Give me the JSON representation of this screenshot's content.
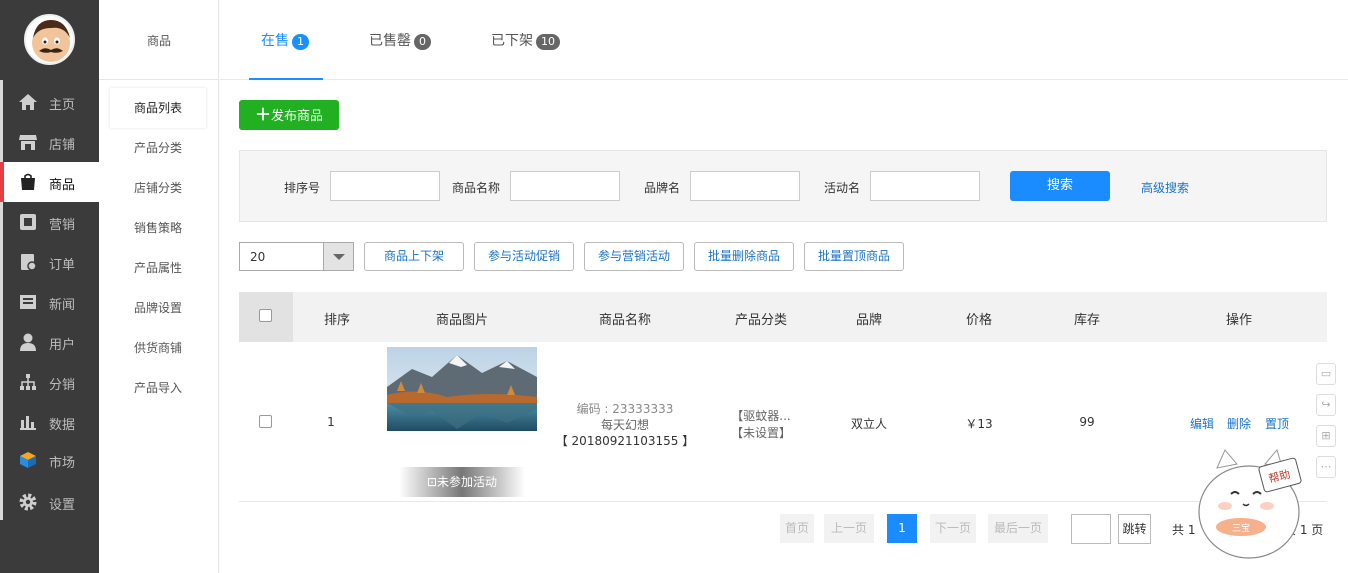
{
  "nav": {
    "items": [
      {
        "label": "主页",
        "icon": "home-icon"
      },
      {
        "label": "店铺",
        "icon": "shop-icon"
      },
      {
        "label": "商品",
        "icon": "bag-icon"
      },
      {
        "label": "营销",
        "icon": "marketing-icon"
      },
      {
        "label": "订单",
        "icon": "order-icon"
      },
      {
        "label": "新闻",
        "icon": "news-icon"
      },
      {
        "label": "用户",
        "icon": "user-icon"
      },
      {
        "label": "分销",
        "icon": "distribution-icon"
      },
      {
        "label": "数据",
        "icon": "chart-icon"
      },
      {
        "label": "市场",
        "icon": "market-icon"
      },
      {
        "label": "设置",
        "icon": "gear-icon"
      }
    ],
    "active_index": 2
  },
  "subnav": {
    "title": "商品",
    "items": [
      "商品列表",
      "产品分类",
      "店铺分类",
      "销售策略",
      "产品属性",
      "品牌设置",
      "供货商铺",
      "产品导入"
    ]
  },
  "tabs": [
    {
      "label": "在售",
      "count": "1"
    },
    {
      "label": "已售罄",
      "count": "0"
    },
    {
      "label": "已下架",
      "count": "10"
    }
  ],
  "toolbar": {
    "publish_label": "发布商品"
  },
  "filter": {
    "sort_label": "排序号",
    "name_label": "商品名称",
    "brand_label": "品牌名",
    "activity_label": "活动名",
    "search_label": "搜索",
    "advanced_label": "高级搜索"
  },
  "bulk": {
    "page_size": "20",
    "actions": [
      "商品上下架",
      "参与活动促销",
      "参与营销活动",
      "批量删除商品",
      "批量置顶商品"
    ]
  },
  "table": {
    "headers": [
      "排序",
      "商品图片",
      "商品名称",
      "产品分类",
      "品牌",
      "价格",
      "库存",
      "操作"
    ],
    "rows": [
      {
        "order": "1",
        "code": "编码 : 23333333",
        "name": "每天幻想",
        "sku": "【 20180921103155 】",
        "category1": "【驱蚊器...",
        "category2": "【未设置】",
        "brand": "双立人",
        "price": "￥13",
        "stock": "99",
        "activity": "未参加活动",
        "ops": [
          "编辑",
          "删除",
          "置顶"
        ]
      }
    ]
  },
  "pager": {
    "first": "首页",
    "prev": "上一页",
    "current": "1",
    "next": "下一页",
    "last": "最后一页",
    "jump": "跳转",
    "total_left": "共 1 ",
    "total_right": "共 1 页"
  },
  "mascot": {
    "sign": "帮助",
    "badge": "三宝"
  },
  "colors": {
    "accent": "#1a8cff",
    "green": "#21b021",
    "active_marker": "#e63f3f",
    "nav_bg": "#3b3b3b"
  }
}
